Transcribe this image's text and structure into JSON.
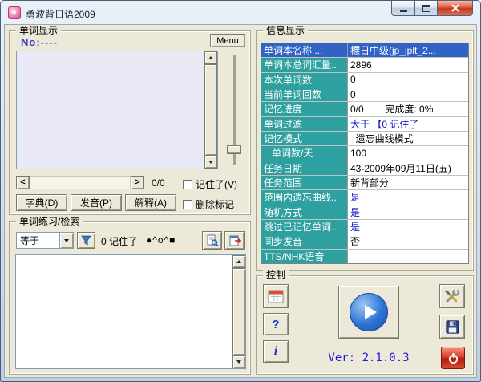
{
  "colors": {
    "accent_selection": "#3163C5",
    "table_label_teal": "#2FA0A0",
    "link_blue": "#1414CC",
    "client_background": "#ECE9D8"
  },
  "window": {
    "title": "勇波背日语2009"
  },
  "word_display": {
    "group_title": "单词显示",
    "no_label": "No:----",
    "menu_button": "Menu",
    "pager": {
      "prev": "<",
      "next": ">",
      "counter": "0/0"
    },
    "remember_checkbox": "记住了(V)",
    "buttons": {
      "dict": "字典(D)",
      "pronounce": "发音(P)",
      "explain": "解释(A)"
    },
    "delete_mark_checkbox": "删除标记"
  },
  "practice": {
    "group_title": "单词练习/检索",
    "filter_value": "等于",
    "count_text": "0 记住了",
    "face_text": "●^o^■"
  },
  "info": {
    "group_title": "信息显示",
    "rows": [
      {
        "label": "单词本名称 ...",
        "value": "標日中级(jp_jplt_2..."
      },
      {
        "label": "单词本总词汇量..",
        "value": "2896"
      },
      {
        "label": "本次单词数",
        "value": "0"
      },
      {
        "label": "当前单词回数",
        "value": "0"
      },
      {
        "label": "记忆进度",
        "value": "0/0        完成度: 0%"
      },
      {
        "label": "单词过滤",
        "value": "大于 【0 记住了"
      },
      {
        "label": "记忆模式",
        "value": "  遗忘曲线模式"
      },
      {
        "label": "   单词数/天",
        "value": "100"
      },
      {
        "label": "任务日期",
        "value": "43-2009年09月11日(五)"
      },
      {
        "label": "任务范围",
        "value": "新背部分"
      },
      {
        "label": "范围内遗忘曲线..",
        "value": "是"
      },
      {
        "label": "随机方式",
        "value": "是"
      },
      {
        "label": "跳过已记忆单词..",
        "value": "是"
      },
      {
        "label": "同步发音",
        "value": "否"
      },
      {
        "label": "TTS/NHK语音",
        "value": ""
      }
    ]
  },
  "control": {
    "group_title": "控制",
    "help_label": "?",
    "info_label": "i",
    "version": "Ver: 2.1.0.3"
  }
}
